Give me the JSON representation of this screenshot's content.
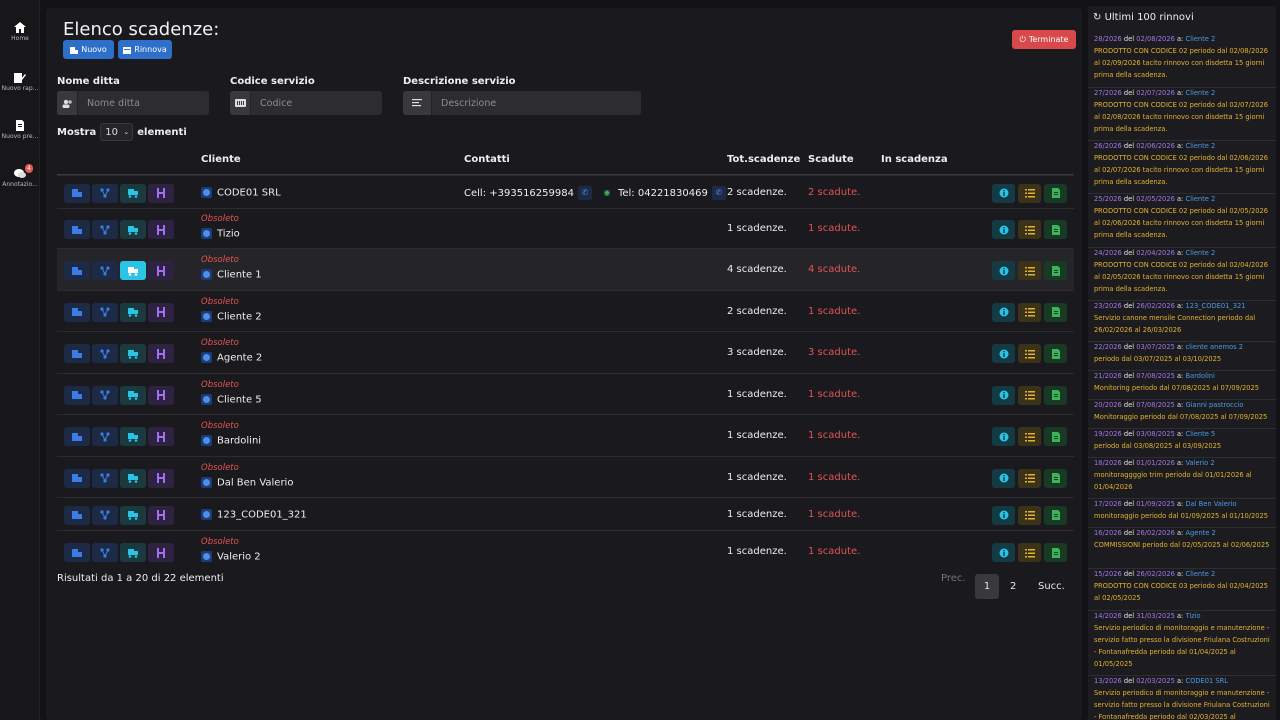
{
  "sidebar": {
    "items": [
      {
        "label": "Home",
        "icon": "home-icon"
      },
      {
        "label": "Nuovo rap...",
        "icon": "edit-report-icon"
      },
      {
        "label": "Nuovo pre...",
        "icon": "document-icon"
      },
      {
        "label": "Annotazio...",
        "icon": "chat-icon",
        "badge": "4"
      }
    ]
  },
  "header": {
    "title": "Elenco scadenze:",
    "new_label": "Nuovo",
    "renew_label": "Rinnova",
    "terminated_label": "Terminate"
  },
  "filters": {
    "company_label": "Nome ditta",
    "company_placeholder": "Nome ditta",
    "code_label": "Codice servizio",
    "code_placeholder": "Codice",
    "desc_label": "Descrizione servizio",
    "desc_placeholder": "Descrizione"
  },
  "table": {
    "show_prefix": "Mostra",
    "show_value": "10",
    "show_suffix": "elementi",
    "headers": {
      "client": "Cliente",
      "contacts": "Contatti",
      "total": "Tot.scadenze",
      "expired": "Scadute",
      "expiring": "In scadenza"
    },
    "rows": [
      {
        "obsolete": "",
        "client": "CODE01 SRL",
        "contact_cell": "Cell: +393516259984",
        "contact_tel": "Tel: 04221830469",
        "total": "2 scadenze.",
        "expired": "2 scadute."
      },
      {
        "obsolete": "Obsoleto",
        "client": "Tizio",
        "contact_cell": "",
        "contact_tel": "",
        "total": "1 scadenze.",
        "expired": "1 scadute."
      },
      {
        "obsolete": "Obsoleto",
        "client": "Cliente 1",
        "contact_cell": "",
        "contact_tel": "",
        "total": "4 scadenze.",
        "expired": "4 scadute."
      },
      {
        "obsolete": "Obsoleto",
        "client": "Cliente 2",
        "contact_cell": "",
        "contact_tel": "",
        "total": "2 scadenze.",
        "expired": "1 scadute."
      },
      {
        "obsolete": "Obsoleto",
        "client": "Agente 2",
        "contact_cell": "",
        "contact_tel": "",
        "total": "3 scadenze.",
        "expired": "3 scadute."
      },
      {
        "obsolete": "Obsoleto",
        "client": "Cliente 5",
        "contact_cell": "",
        "contact_tel": "",
        "total": "1 scadenze.",
        "expired": "1 scadute."
      },
      {
        "obsolete": "Obsoleto",
        "client": "Bardolini",
        "contact_cell": "",
        "contact_tel": "",
        "total": "1 scadenze.",
        "expired": "1 scadute."
      },
      {
        "obsolete": "Obsoleto",
        "client": "Dal Ben Valerio",
        "contact_cell": "",
        "contact_tel": "",
        "total": "1 scadenze.",
        "expired": "1 scadute."
      },
      {
        "obsolete": "",
        "client": "123_CODE01_321",
        "contact_cell": "",
        "contact_tel": "",
        "total": "1 scadenze.",
        "expired": "1 scadute."
      },
      {
        "obsolete": "Obsoleto",
        "client": "Valerio 2",
        "contact_cell": "",
        "contact_tel": "",
        "total": "1 scadenze.",
        "expired": "1 scadute."
      }
    ]
  },
  "footer": {
    "results": "Risultati da 1 a 20 di 22 elementi",
    "prev": "Prec.",
    "page1": "1",
    "page2": "2",
    "next": "Succ."
  },
  "renewals": {
    "title": "Ultimi 100 rinnovi",
    "entries": [
      {
        "num": "28/2026",
        "del": "del",
        "date": "02/08/2026",
        "a": "a:",
        "client": "Cliente 2",
        "text": "PRODOTTO CON CODICE 02 periodo dal 02/08/2026 al 02/09/2026 tacito rinnovo con disdetta 15 giorni prima della scadenza."
      },
      {
        "num": "27/2026",
        "del": "del",
        "date": "02/07/2026",
        "a": "a:",
        "client": "Cliente 2",
        "text": "PRODOTTO CON CODICE 02 periodo dal 02/07/2026 al 02/08/2026 tacito rinnovo con disdetta 15 giorni prima della scadenza."
      },
      {
        "num": "26/2026",
        "del": "del",
        "date": "02/06/2026",
        "a": "a:",
        "client": "Cliente 2",
        "text": "PRODOTTO CON CODICE 02 periodo dal 02/06/2026 al 02/07/2026 tacito rinnovo con disdetta 15 giorni prima della scadenza."
      },
      {
        "num": "25/2026",
        "del": "del",
        "date": "02/05/2026",
        "a": "a:",
        "client": "Cliente 2",
        "text": "PRODOTTO CON CODICE 02 periodo dal 02/05/2026 al 02/06/2026 tacito rinnovo con disdetta 15 giorni prima della scadenza."
      },
      {
        "num": "24/2026",
        "del": "del",
        "date": "02/04/2026",
        "a": "a:",
        "client": "Cliente 2",
        "text": "PRODOTTO CON CODICE 02 periodo dal 02/04/2026 al 02/05/2026 tacito rinnovo con disdetta 15 giorni prima della scadenza."
      },
      {
        "num": "23/2026",
        "del": "del",
        "date": "26/02/2026",
        "a": "a:",
        "client": "123_CODE01_321",
        "text": "Servizio canone mensile Connection periodo dal 26/02/2026 al 26/03/2026"
      },
      {
        "num": "22/2026",
        "del": "del",
        "date": "03/07/2025",
        "a": "a:",
        "client": "cliente anemos 2",
        "text": "periodo dal 03/07/2025 al 03/10/2025"
      },
      {
        "num": "21/2026",
        "del": "del",
        "date": "07/08/2025",
        "a": "a:",
        "client": "Bardolini",
        "text": "Monitoring periodo dal 07/08/2025 al 07/09/2025"
      },
      {
        "num": "20/2026",
        "del": "del",
        "date": "07/08/2025",
        "a": "a:",
        "client": "Gianni pastroccio",
        "text": "Monitoraggio periodo dal 07/08/2025 al 07/09/2025"
      },
      {
        "num": "19/2026",
        "del": "del",
        "date": "03/08/2025",
        "a": "a:",
        "client": "Cliente 5",
        "text": "periodo dal 03/08/2025 al 03/09/2025"
      },
      {
        "num": "18/2026",
        "del": "del",
        "date": "01/01/2026",
        "a": "a:",
        "client": "Valerio 2",
        "text": "monitoraggggio trim periodo dal 01/01/2026 al 01/04/2026"
      },
      {
        "num": "17/2026",
        "del": "del",
        "date": "01/09/2025",
        "a": "a:",
        "client": "Dal Ben Valerio",
        "text": "monitoraggio periodo dal 01/09/2025 al 01/10/2025"
      },
      {
        "num": "16/2026",
        "del": "del",
        "date": "26/02/2026",
        "a": "a:",
        "client": "Agente 2",
        "text": "COMMISSIONI periodo dal 02/05/2025 al 02/06/2025"
      },
      {
        "num": "15/2026",
        "del": "del",
        "date": "26/02/2026",
        "a": "a:",
        "client": "Cliente 2",
        "text": "PRODOTTO CON CODICE 03 periodo dal 02/04/2025 al 02/05/2025"
      },
      {
        "num": "14/2026",
        "del": "del",
        "date": "31/03/2025",
        "a": "a:",
        "client": "Tizio",
        "text": "Servizio periodico di monitoraggio e manutenzione - servizio fatto presso la divisione Friulana Costruzioni - Fontanafredda periodo dal 01/04/2025 al 01/05/2025"
      },
      {
        "num": "13/2026",
        "del": "del",
        "date": "02/03/2025",
        "a": "a:",
        "client": "CODE01 SRL",
        "text": "Servizio periodico di monitoraggio e manutenzione - servizio fatto presso la divisione Friulana Costruzioni - Fontanafredda periodo dal 02/03/2025 al"
      }
    ]
  }
}
